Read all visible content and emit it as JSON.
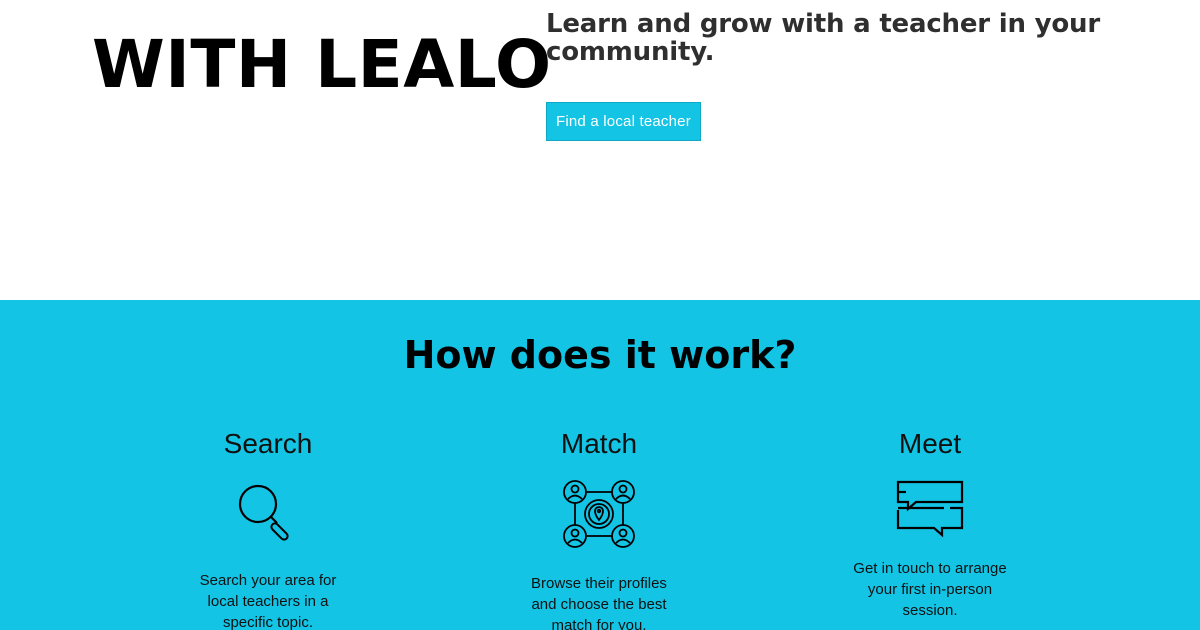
{
  "hero": {
    "brand_title": "WITH LEALO",
    "heading": "Learn and grow with a teacher in your community.",
    "cta_label": "Find a local teacher"
  },
  "how": {
    "title": "How does it work?",
    "steps": [
      {
        "title": "Search",
        "icon": "magnifier-icon",
        "description": "Search your area for local teachers in a specific topic."
      },
      {
        "title": "Match",
        "icon": "network-people-icon",
        "description": "Browse their profiles and choose the best match for you."
      },
      {
        "title": "Meet",
        "icon": "chat-bubbles-icon",
        "description": "Get in touch to arrange your first in-person session."
      }
    ]
  },
  "colors": {
    "accent": "#13c4e5",
    "heading_dark": "#2f2f2f",
    "text": "#111111"
  }
}
